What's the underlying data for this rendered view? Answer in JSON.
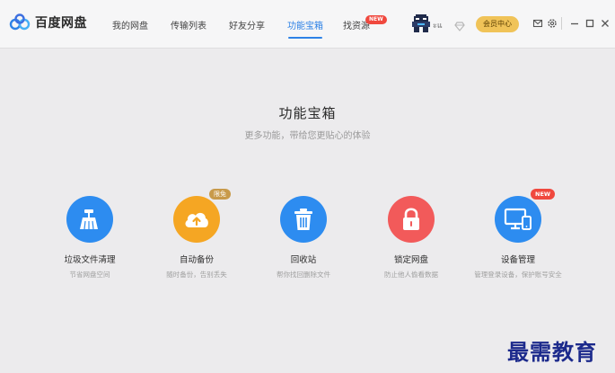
{
  "app": {
    "name": "百度网盘"
  },
  "nav": {
    "items": [
      {
        "label": "我的网盘"
      },
      {
        "label": "传输列表"
      },
      {
        "label": "好友分享"
      },
      {
        "label": "功能宝箱"
      },
      {
        "label": "找资源"
      }
    ],
    "active": "功能宝箱",
    "new_badge": "NEW"
  },
  "user": {
    "name": "ะแ",
    "vip_label": "会员中心"
  },
  "page": {
    "title": "功能宝箱",
    "subtitle": "更多功能，带给您更贴心的体验"
  },
  "tools": [
    {
      "name": "垃圾文件清理",
      "desc": "节省网盘空间",
      "icon": "broom-icon",
      "color": "#2d8cf0"
    },
    {
      "name": "自动备份",
      "desc": "随时备份，告别丢失",
      "icon": "cloud-upload-icon",
      "color": "#f5a623",
      "badge": "限免"
    },
    {
      "name": "回收站",
      "desc": "帮你找回删除文件",
      "icon": "trash-icon",
      "color": "#2d8cf0"
    },
    {
      "name": "锁定网盘",
      "desc": "防止他人偷看数据",
      "icon": "lock-icon",
      "color": "#f25a5a"
    },
    {
      "name": "设备管理",
      "desc": "管理登录设备，保护账号安全",
      "icon": "devices-icon",
      "color": "#2d8cf0",
      "badge": "NEW"
    }
  ],
  "watermark": "最需教育"
}
